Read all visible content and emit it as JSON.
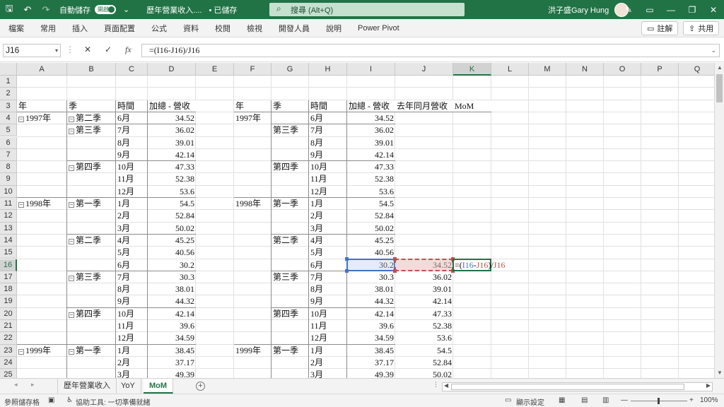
{
  "titlebar": {
    "autosave_label": "自動儲存",
    "autosave_state": "開啟",
    "filename": "歷年營業收入....",
    "saved_status": "• 已儲存",
    "search_placeholder": "搜尋 (Alt+Q)",
    "user_name": "洪子盛Gary Hung"
  },
  "ribbon": {
    "tabs": [
      "檔案",
      "常用",
      "插入",
      "頁面配置",
      "公式",
      "資料",
      "校閱",
      "檢視",
      "開發人員",
      "說明",
      "Power Pivot"
    ],
    "comment_label": "註解",
    "share_label": "共用"
  },
  "formula_bar": {
    "name_box": "J16",
    "formula_text": "=(I16-J16)/J16"
  },
  "grid": {
    "columns": [
      "A",
      "B",
      "C",
      "D",
      "E",
      "F",
      "G",
      "H",
      "I",
      "J",
      "K",
      "L",
      "M",
      "N",
      "O",
      "P",
      "Q"
    ],
    "rows": [
      "1",
      "2",
      "3",
      "4",
      "5",
      "6",
      "7",
      "8",
      "9",
      "10",
      "11",
      "12",
      "13",
      "14",
      "15",
      "16",
      "17",
      "18",
      "19",
      "20",
      "21",
      "22",
      "23",
      "24",
      "25"
    ],
    "selected_column": "K",
    "selected_row": "16",
    "pivot_headers": [
      "年",
      "季",
      "時間",
      "加總 - 營收"
    ],
    "table_headers": [
      "年",
      "季",
      "時間",
      "加總 - 營收",
      "去年同月營收",
      "MoM"
    ],
    "years": [
      {
        "row": 4,
        "label": "1997年"
      },
      {
        "row": 11,
        "label": "1998年"
      },
      {
        "row": 23,
        "label": "1999年"
      }
    ],
    "quarters": [
      {
        "row": 4,
        "label": "第二季"
      },
      {
        "row": 5,
        "label": "第三季"
      },
      {
        "row": 8,
        "label": "第四季"
      },
      {
        "row": 11,
        "label": "第一季"
      },
      {
        "row": 14,
        "label": "第二季"
      },
      {
        "row": 17,
        "label": "第三季"
      },
      {
        "row": 20,
        "label": "第四季"
      },
      {
        "row": 23,
        "label": "第一季"
      }
    ],
    "data_rows": [
      {
        "row": 4,
        "month": "6月",
        "revenue": "34.52",
        "prior": ""
      },
      {
        "row": 5,
        "month": "7月",
        "revenue": "36.02",
        "prior": ""
      },
      {
        "row": 6,
        "month": "8月",
        "revenue": "39.01",
        "prior": ""
      },
      {
        "row": 7,
        "month": "9月",
        "revenue": "42.14",
        "prior": ""
      },
      {
        "row": 8,
        "month": "10月",
        "revenue": "47.33",
        "prior": ""
      },
      {
        "row": 9,
        "month": "11月",
        "revenue": "52.38",
        "prior": ""
      },
      {
        "row": 10,
        "month": "12月",
        "revenue": "53.6",
        "prior": ""
      },
      {
        "row": 11,
        "month": "1月",
        "revenue": "54.5",
        "prior": ""
      },
      {
        "row": 12,
        "month": "2月",
        "revenue": "52.84",
        "prior": ""
      },
      {
        "row": 13,
        "month": "3月",
        "revenue": "50.02",
        "prior": ""
      },
      {
        "row": 14,
        "month": "4月",
        "revenue": "45.25",
        "prior": ""
      },
      {
        "row": 15,
        "month": "5月",
        "revenue": "40.56",
        "prior": ""
      },
      {
        "row": 16,
        "month": "6月",
        "revenue": "30.2",
        "prior": "34.52"
      },
      {
        "row": 17,
        "month": "7月",
        "revenue": "30.3",
        "prior": "36.02"
      },
      {
        "row": 18,
        "month": "8月",
        "revenue": "38.01",
        "prior": "39.01"
      },
      {
        "row": 19,
        "month": "9月",
        "revenue": "44.32",
        "prior": "42.14"
      },
      {
        "row": 20,
        "month": "10月",
        "revenue": "42.14",
        "prior": "47.33"
      },
      {
        "row": 21,
        "month": "11月",
        "revenue": "39.6",
        "prior": "52.38"
      },
      {
        "row": 22,
        "month": "12月",
        "revenue": "34.59",
        "prior": "53.6"
      },
      {
        "row": 23,
        "month": "1月",
        "revenue": "38.45",
        "prior": "54.5"
      },
      {
        "row": 24,
        "month": "2月",
        "revenue": "37.17",
        "prior": "52.84"
      },
      {
        "row": 25,
        "month": "3月",
        "revenue": "49.39",
        "prior": "50.02"
      }
    ],
    "editing_cell_parts": [
      "=(",
      "I16",
      "-",
      "J16",
      ")/",
      "J16"
    ]
  },
  "sheets": {
    "tabs": [
      "歷年營業收入",
      "YoY",
      "MoM"
    ],
    "active": "MoM"
  },
  "status_bar": {
    "mode": "參照儲存格",
    "accessibility": "協助工具: 一切準備就緒",
    "display_settings": "顯示設定",
    "zoom": "100%"
  },
  "colors": {
    "excel_green": "#217346",
    "ref_blue": "#4472c4",
    "ref_red": "#c0504d"
  }
}
